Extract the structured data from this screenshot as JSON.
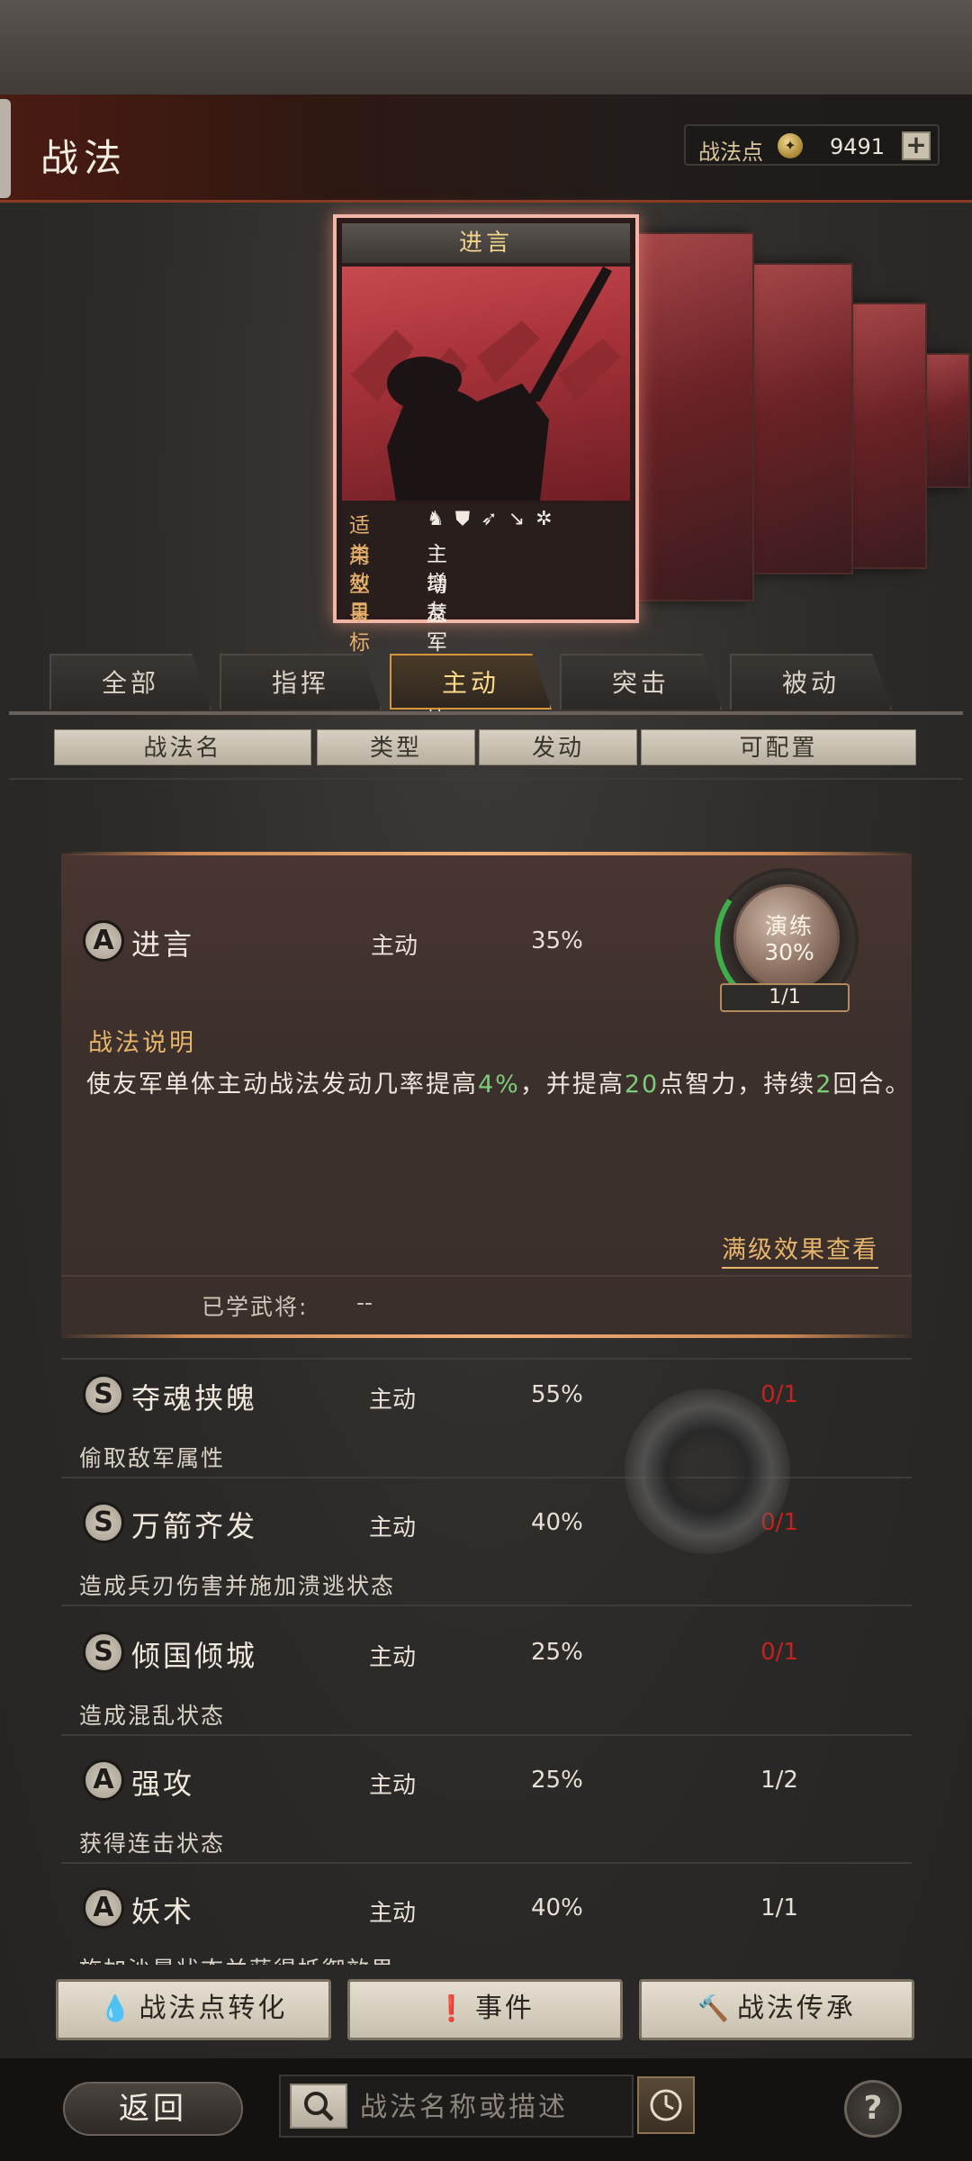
{
  "header": {
    "title": "战法",
    "points_label": "战法点",
    "points_value": "9491",
    "plus_label": "+"
  },
  "card": {
    "title": "进言",
    "info": [
      {
        "key": "适用",
        "value": ""
      },
      {
        "key": "类型",
        "value": "主动"
      },
      {
        "key": "效果",
        "value": "增益"
      },
      {
        "key": "目标",
        "value": "友军单体"
      }
    ]
  },
  "tabs": [
    {
      "label": "全部",
      "active": false
    },
    {
      "label": "指挥",
      "active": false
    },
    {
      "label": "主动",
      "active": true
    },
    {
      "label": "突击",
      "active": false
    },
    {
      "label": "被动",
      "active": false
    }
  ],
  "columns": [
    "战法名",
    "类型",
    "发动",
    "可配置"
  ],
  "expanded": {
    "grade": "A",
    "name": "进言",
    "type": "主动",
    "rate": "35%",
    "drill_label": "演练",
    "drill_pct": "30%",
    "drill_count": "1/1",
    "desc_title": "战法说明",
    "desc_parts": [
      "使友军单体主动战法发动几率提高",
      "4%",
      "，并提高",
      "20",
      "点智力，持续",
      "2",
      "回合。"
    ],
    "full_effect_link": "满级效果查看",
    "learned_label": "已学武将:",
    "learned_value": "--"
  },
  "skills": [
    {
      "grade": "S",
      "name": "夺魂挟魄",
      "type": "主动",
      "rate": "55%",
      "config": "0/1",
      "config_red": true,
      "desc": "偷取敌军属性"
    },
    {
      "grade": "S",
      "name": "万箭齐发",
      "type": "主动",
      "rate": "40%",
      "config": "0/1",
      "config_red": true,
      "desc": "造成兵刃伤害并施加溃逃状态"
    },
    {
      "grade": "S",
      "name": "倾国倾城",
      "type": "主动",
      "rate": "25%",
      "config": "0/1",
      "config_red": true,
      "desc": "造成混乱状态"
    },
    {
      "grade": "A",
      "name": "强攻",
      "type": "主动",
      "rate": "25%",
      "config": "1/2",
      "config_red": false,
      "desc": "获得连击状态"
    },
    {
      "grade": "A",
      "name": "妖术",
      "type": "主动",
      "rate": "40%",
      "config": "1/1",
      "config_red": false,
      "desc": "施加沙暴状态并获得抵御效果"
    }
  ],
  "actions": [
    {
      "label": "战法点转化",
      "icon": "drop-icon"
    },
    {
      "label": "事件",
      "icon": "event-icon"
    },
    {
      "label": "战法传承",
      "icon": "hammer-icon"
    }
  ],
  "footer": {
    "back_label": "返回",
    "search_placeholder": "战法名称或描述",
    "help_label": "?"
  }
}
